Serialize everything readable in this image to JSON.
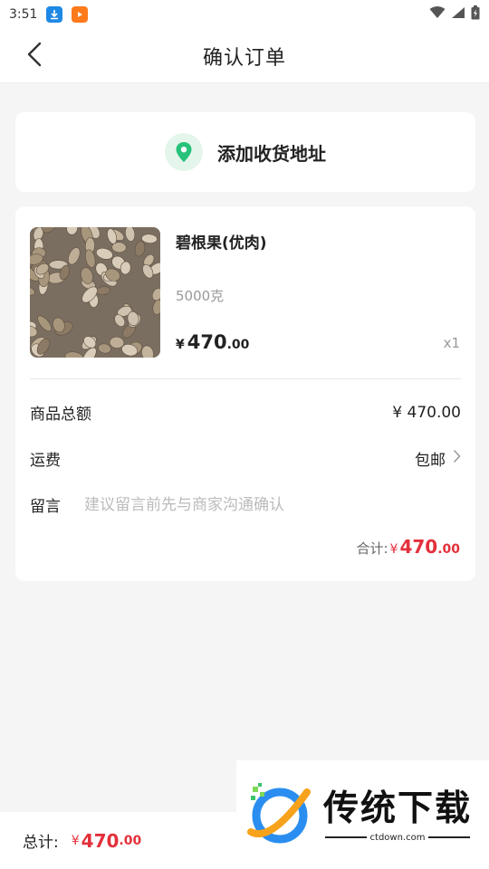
{
  "status_bar": {
    "time": "3:51",
    "icons": [
      "download-icon",
      "video-app-icon",
      "wifi-icon",
      "signal-icon",
      "battery-icon"
    ]
  },
  "header": {
    "title": "确认订单",
    "back_icon": "chevron-left-icon"
  },
  "address": {
    "label": "添加收货地址",
    "icon": "location-pin-icon",
    "accent": "#27c27a"
  },
  "product": {
    "name": "碧根果(优肉)",
    "spec": "5000克",
    "price_currency": "¥",
    "price_integer": "470",
    "price_decimal": ".00",
    "quantity": "x1"
  },
  "summary": {
    "goods_total_label": "商品总额",
    "goods_total_value": "¥ 470.00",
    "shipping_label": "运费",
    "shipping_value": "包邮",
    "note_label": "留言",
    "note_placeholder": "建议留言前先与商家沟通确认",
    "subtotal_label": "合计:",
    "subtotal_currency": "¥",
    "subtotal_integer": "470",
    "subtotal_decimal": ".00"
  },
  "bottom_bar": {
    "total_label": "总计:",
    "total_currency": "¥",
    "total_integer": "470",
    "total_decimal": ".00"
  },
  "watermark": {
    "title": "传统下载",
    "url": "ctdown.com"
  },
  "colors": {
    "price_red": "#e3303b",
    "background": "#f5f5f6"
  }
}
